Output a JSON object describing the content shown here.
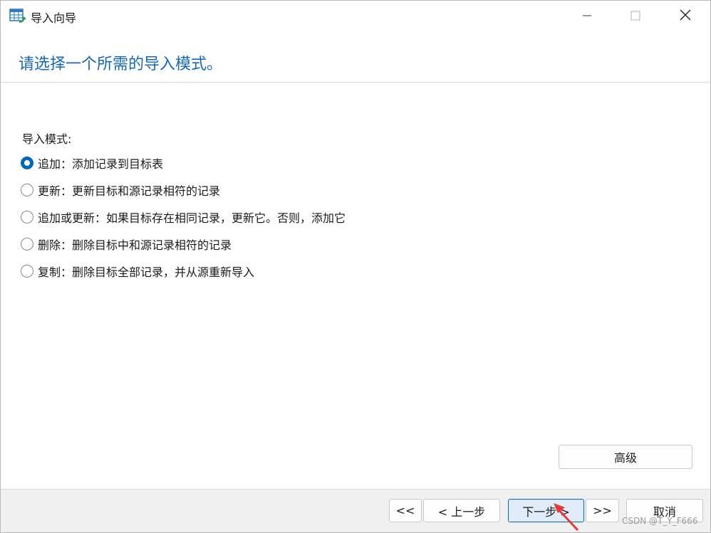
{
  "window": {
    "title": "导入向导",
    "icon": "table-import-icon"
  },
  "titlebar_controls": [
    "minimize-icon",
    "maximize-icon",
    "close-icon"
  ],
  "headline": "请选择一个所需的导入模式。",
  "mode_section": {
    "label": "导入模式:",
    "options": [
      {
        "label": "追加：添加记录到目标表",
        "checked": true
      },
      {
        "label": "更新：更新目标和源记录相符的记录",
        "checked": false
      },
      {
        "label": "追加或更新：如果目标存在相同记录，更新它。否则，添加它",
        "checked": false
      },
      {
        "label": "删除：删除目标中和源记录相符的记录",
        "checked": false
      },
      {
        "label": "复制：删除目标全部记录，并从源重新导入",
        "checked": false
      }
    ]
  },
  "advanced_button": "高级",
  "nav": {
    "first": "<<",
    "prev": "< 上一步",
    "next": "下一步 >",
    "last": ">>",
    "cancel": "取消"
  },
  "colors": {
    "accent": "#0067c0",
    "headline": "#1669b7",
    "annotation_arrow": "#e53935"
  },
  "watermark": "CSDN @T_Y_F666"
}
